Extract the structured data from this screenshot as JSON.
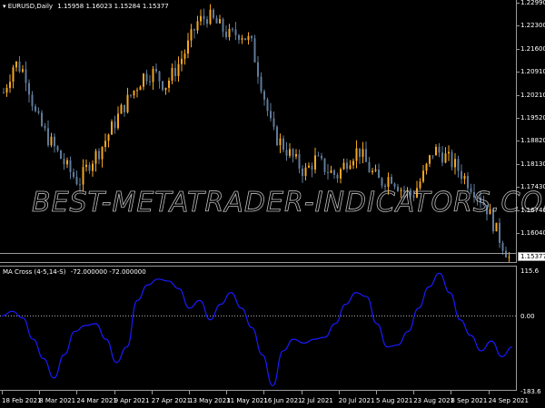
{
  "main": {
    "symbol_label": "EURUSD,Daily",
    "ohlc": "1.15958 1.16023 1.15284 1.15377",
    "current_price": "1.15377",
    "price_axis": [
      "1.22990",
      "1.22300",
      "1.21600",
      "1.20910",
      "1.20210",
      "1.19520",
      "1.18820",
      "1.18130",
      "1.17430",
      "1.16740",
      "1.16040"
    ],
    "price_range": [
      1.1537,
      1.2299
    ],
    "price_path": [
      1.203,
      1.212,
      1.209,
      1.196,
      1.19,
      1.185,
      1.18,
      1.176,
      1.182,
      1.186,
      1.192,
      1.198,
      1.203,
      1.208,
      1.209,
      1.205,
      1.21,
      1.216,
      1.224,
      1.226,
      1.223,
      1.22,
      1.221,
      1.218,
      1.205,
      1.191,
      1.187,
      1.183,
      1.179,
      1.183,
      1.18,
      1.178,
      1.183,
      1.186,
      1.18,
      1.176,
      1.178,
      1.174,
      1.172,
      1.178,
      1.186,
      1.184,
      1.181,
      1.177,
      1.173,
      1.168,
      1.16,
      1.1538
    ],
    "watermark": "BEST-METATRADER-INDICATORS.COM",
    "colors": {
      "bull": "#f5a623",
      "bear": "#5f7a99"
    }
  },
  "indicator": {
    "label": "MA Cross (4-5,14-S)",
    "values_label": "-72.000000 -72.000000",
    "axis": {
      "top": "115.6",
      "zero": "0.00",
      "bottom": "-183.6"
    },
    "range": [
      -183.6,
      115.6
    ],
    "series": [
      0,
      12,
      -5,
      -60,
      -110,
      -160,
      -100,
      -40,
      -25,
      -20,
      -60,
      -120,
      -80,
      40,
      80,
      95,
      90,
      70,
      20,
      40,
      -10,
      30,
      60,
      20,
      -30,
      -100,
      -180,
      -90,
      -60,
      -70,
      -60,
      -55,
      -20,
      30,
      60,
      50,
      -20,
      -80,
      -75,
      -40,
      20,
      75,
      110,
      60,
      -10,
      -50,
      -90,
      -65,
      -105,
      -80
    ],
    "color": "#1a1aff"
  },
  "time_axis": [
    "18 Feb 2021",
    "8 Mar 2021",
    "24 Mar 2021",
    "9 Apr 2021",
    "27 Apr 2021",
    "13 May 2021",
    "31 May 2021",
    "16 Jun 2021",
    "2 Jul 2021",
    "20 Jul 2021",
    "5 Aug 2021",
    "23 Aug 2021",
    "8 Sep 2021",
    "24 Sep 2021"
  ]
}
